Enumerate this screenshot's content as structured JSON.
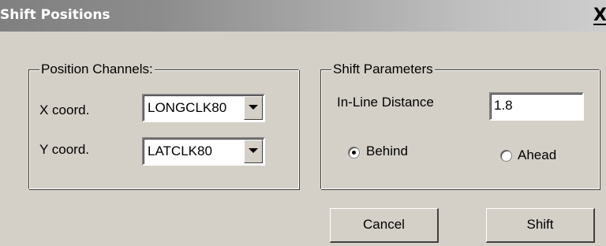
{
  "window": {
    "title": "Shift Positions",
    "close_label": "X"
  },
  "position_channels": {
    "legend": "Position Channels:",
    "x_label": "X coord.",
    "x_value": "LONGCLK80",
    "y_label": "Y coord.",
    "y_value": "LATCLK80"
  },
  "shift_parameters": {
    "legend": "Shift Parameters",
    "distance_label": "In-Line Distance",
    "distance_value": "1.8",
    "behind_label": "Behind",
    "behind_selected": true,
    "ahead_label": "Ahead",
    "ahead_selected": false
  },
  "buttons": {
    "cancel_label": "Cancel",
    "shift_label": "Shift"
  }
}
